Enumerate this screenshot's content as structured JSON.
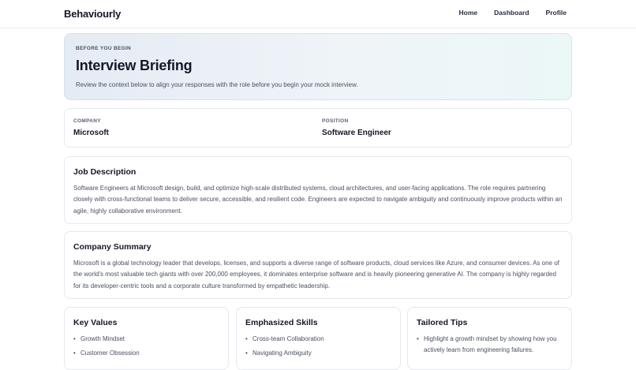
{
  "brand": "Behaviourly",
  "nav": {
    "items": [
      "Home",
      "Dashboard",
      "Profile"
    ]
  },
  "hero": {
    "eyebrow": "BEFORE YOU BEGIN",
    "title": "Interview Briefing",
    "subtitle": "Review the context below to align your responses with the role before you begin your mock interview."
  },
  "meta": {
    "company_label": "COMPANY",
    "company_value": "Microsoft",
    "position_label": "POSITION",
    "position_value": "Software Engineer"
  },
  "job_description": {
    "title": "Job Description",
    "body": "Software Engineers at Microsoft design, build, and optimize high-scale distributed systems, cloud architectures, and user-facing applications. The role requires partnering closely with cross-functional teams to deliver secure, accessible, and resilient code. Engineers are expected to navigate ambiguity and continuously improve products within an agile, highly collaborative environment."
  },
  "company_summary": {
    "title": "Company Summary",
    "body": "Microsoft is a global technology leader that develops, licenses, and supports a diverse range of software products, cloud services like Azure, and consumer devices. As one of the world's most valuable tech giants with over 200,000 employees, it dominates enterprise software and is heavily pioneering generative AI. The company is highly regarded for its developer-centric tools and a corporate culture transformed by empathetic leadership."
  },
  "key_values": {
    "title": "Key Values",
    "items": [
      "Growth Mindset",
      "Customer Obsession"
    ]
  },
  "skills": {
    "title": "Emphasized Skills",
    "items": [
      "Cross-team Collaboration",
      "Navigating Ambiguity"
    ]
  },
  "tips": {
    "title": "Tailored Tips",
    "items": [
      "Highlight a growth mindset by showing how you actively learn from engineering failures."
    ]
  }
}
